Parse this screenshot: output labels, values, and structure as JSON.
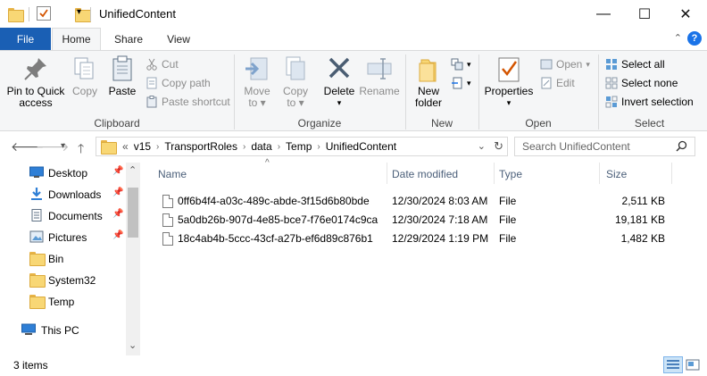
{
  "window": {
    "title": "UnifiedContent",
    "minimize": "—",
    "maximize": "☐",
    "close": "✕"
  },
  "tabs": [
    {
      "label": "File"
    },
    {
      "label": "Home"
    },
    {
      "label": "Share"
    },
    {
      "label": "View"
    }
  ],
  "help_label": "?",
  "ribbon": {
    "clipboard": {
      "label": "Clipboard",
      "pin": "Pin to Quick access",
      "pin_l1": "Pin to Quick",
      "pin_l2": "access",
      "copy": "Copy",
      "paste": "Paste",
      "cut": "Cut",
      "copy_path": "Copy path",
      "paste_shortcut": "Paste shortcut"
    },
    "organize": {
      "label": "Organize",
      "move_l1": "Move",
      "move_l2": "to",
      "copy_l1": "Copy",
      "copy_l2": "to",
      "delete": "Delete",
      "rename": "Rename"
    },
    "new": {
      "label": "New",
      "new_l1": "New",
      "new_l2": "folder"
    },
    "open": {
      "label": "Open",
      "properties": "Properties",
      "open": "Open",
      "edit": "Edit"
    },
    "select": {
      "label": "Select",
      "all": "Select all",
      "none": "Select none",
      "invert": "Invert selection"
    }
  },
  "address": {
    "prefix": "«",
    "crumbs": [
      "v15",
      "TransportRoles",
      "data",
      "Temp",
      "UnifiedContent"
    ],
    "search_placeholder": "Search UnifiedContent"
  },
  "nav": [
    {
      "label": "Desktop",
      "pinned": true
    },
    {
      "label": "Downloads",
      "pinned": true
    },
    {
      "label": "Documents",
      "pinned": true
    },
    {
      "label": "Pictures",
      "pinned": true
    },
    {
      "label": "Bin",
      "pinned": false
    },
    {
      "label": "System32",
      "pinned": false
    },
    {
      "label": "Temp",
      "pinned": false
    },
    {
      "label": "This PC",
      "pinned": false
    }
  ],
  "columns": {
    "name": "Name",
    "date": "Date modified",
    "type": "Type",
    "size": "Size"
  },
  "files": [
    {
      "name": "0ff6b4f4-a03c-489c-abde-3f15d6b80bde",
      "date": "12/30/2024 8:03 AM",
      "type": "File",
      "size": "2,511 KB"
    },
    {
      "name": "5a0db26b-907d-4e85-bce7-f76e0174c9ca",
      "date": "12/30/2024 7:18 AM",
      "type": "File",
      "size": "19,181 KB"
    },
    {
      "name": "18c4ab4b-5ccc-43cf-a27b-ef6d89c876b1",
      "date": "12/29/2024 1:19 PM",
      "type": "File",
      "size": "1,482 KB"
    }
  ],
  "status": {
    "items": "3 items"
  },
  "colors": {
    "accent": "#1a5fb4",
    "folder": "#f8d775"
  }
}
